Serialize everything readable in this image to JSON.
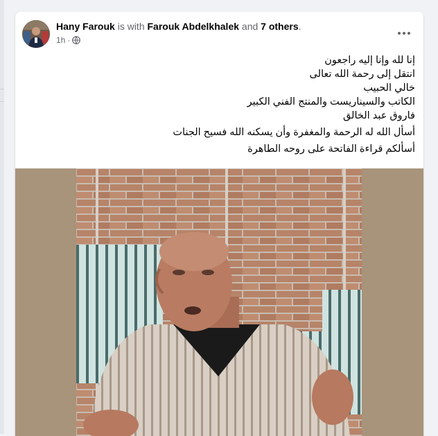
{
  "post": {
    "author": "Hany Farouk",
    "with_text": "is with",
    "tagged_person": "Farouk Abdelkhalek",
    "and_text": "and",
    "others_text": "7 others",
    "period": ".",
    "timestamp": "1h",
    "separator": "·",
    "audience_icon": "globe-icon",
    "more_icon": "more-horizontal-icon",
    "text_lines": [
      "إنا لله وإنا إليه راجعون",
      "انتقل إلى رحمة الله تعالى",
      "خالي الحبيب",
      "الكاتب والسيناريست والمنتج الفني الكبير",
      "فاروق عبد الخالق",
      "أسأل الله له الرحمة والمغفرة وأن يسكنه الله فسيح الجنات",
      "أسألكم قراءة الفاتحة على روحه الطاهرة"
    ]
  },
  "colors": {
    "page_bg": "#f0f2f5",
    "card_bg": "#ffffff",
    "name_text": "#050505",
    "secondary_text": "#65676b",
    "media_bg": "#a8937b"
  }
}
